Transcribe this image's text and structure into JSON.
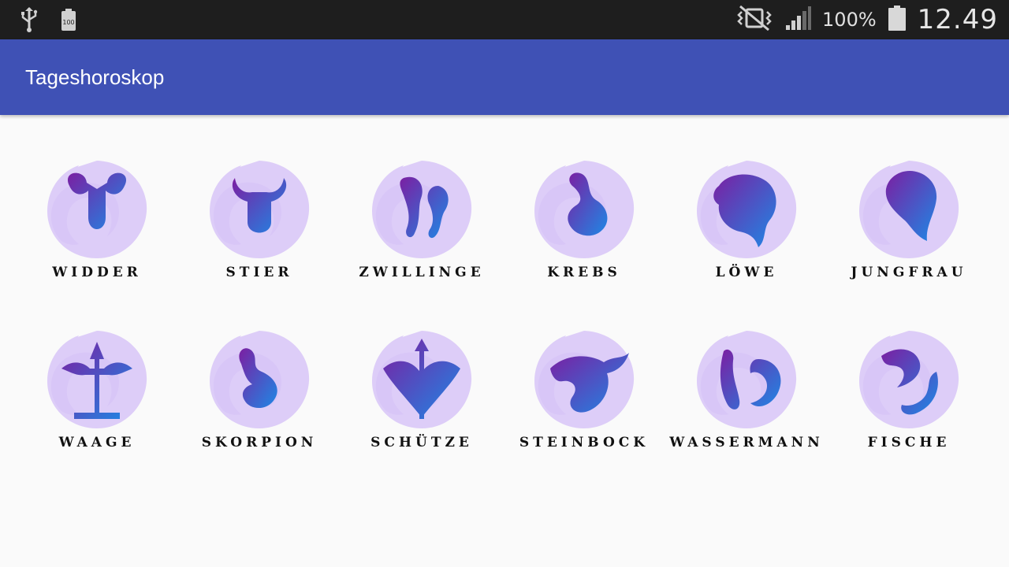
{
  "status_bar": {
    "battery_percent": "100%",
    "time": "12.49",
    "icons": [
      "usb-icon",
      "battery-saver-icon",
      "vibrate-off-icon",
      "signal-icon",
      "battery-icon"
    ]
  },
  "app_bar": {
    "title": "Tageshoroskop"
  },
  "signs": [
    {
      "label": "Widder",
      "icon": "aries-icon"
    },
    {
      "label": "Stier",
      "icon": "taurus-icon"
    },
    {
      "label": "Zwillinge",
      "icon": "gemini-icon"
    },
    {
      "label": "Krebs",
      "icon": "cancer-icon"
    },
    {
      "label": "Löwe",
      "icon": "leo-icon"
    },
    {
      "label": "Jungfrau",
      "icon": "virgo-icon"
    },
    {
      "label": "Waage",
      "icon": "libra-icon"
    },
    {
      "label": "Skorpion",
      "icon": "scorpio-icon"
    },
    {
      "label": "Schütze",
      "icon": "sagittarius-icon"
    },
    {
      "label": "Steinbock",
      "icon": "capricorn-icon"
    },
    {
      "label": "Wassermann",
      "icon": "aquarius-icon"
    },
    {
      "label": "Fische",
      "icon": "pisces-icon"
    }
  ],
  "colors": {
    "app_bar": "#3f51b5",
    "icon_gradient_start": "#7b1fa2",
    "icon_gradient_end": "#1e88e5",
    "icon_background": "#d7c4f7"
  }
}
